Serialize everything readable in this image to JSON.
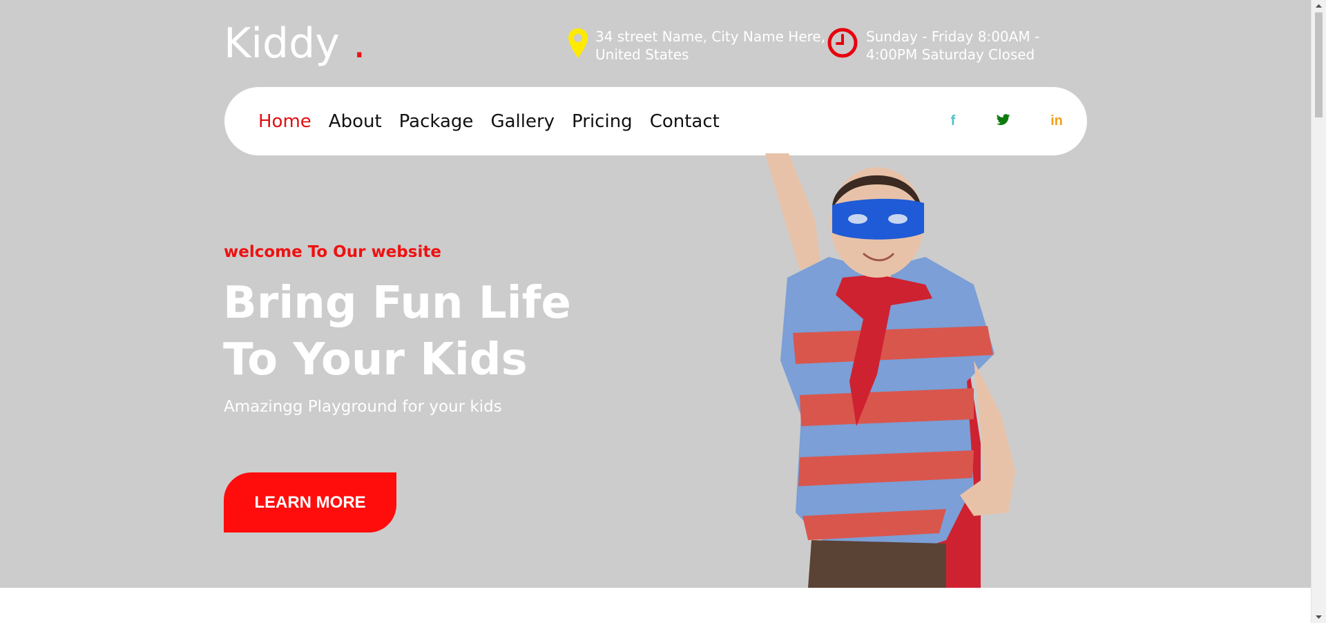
{
  "logo": {
    "text": "Kiddy ",
    "dot": "."
  },
  "header": {
    "address_line1": "34 street Name, City Name Here,",
    "address_line2": "United States",
    "hours_line1": "Sunday - Friday 8:00AM -",
    "hours_line2": "4:00PM Saturday Closed"
  },
  "nav": {
    "items": [
      {
        "label": "Home"
      },
      {
        "label": "About"
      },
      {
        "label": "Package"
      },
      {
        "label": "Gallery"
      },
      {
        "label": "Pricing"
      },
      {
        "label": "Contact"
      }
    ],
    "social": [
      {
        "icon": "facebook-icon",
        "glyph": "f",
        "color": "#4fc1cf"
      },
      {
        "icon": "twitter-icon",
        "color": "#0c7a0c"
      },
      {
        "icon": "linkedin-icon",
        "glyph": "in",
        "color": "#f0a21a"
      }
    ]
  },
  "hero": {
    "welcome": "welcome To Our website",
    "title_line1": "Bring Fun Life",
    "title_line2": "To Your Kids",
    "subtitle": "Amazingg Playground for your kids",
    "button_label": "LEARN MORE"
  },
  "colors": {
    "hero_bg": "#cccccc",
    "accent_red": "#ee1111",
    "location_pin": "#ffea00"
  }
}
